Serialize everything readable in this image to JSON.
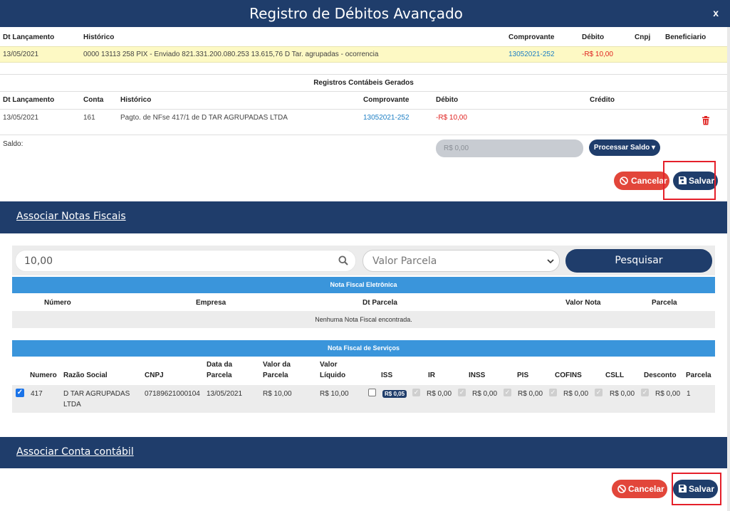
{
  "modal": {
    "title": "Registro de Débitos Avançado",
    "close": "x"
  },
  "debito": {
    "headers": [
      "Dt Lançamento",
      "Histórico",
      "Comprovante",
      "Débito",
      "Cnpj",
      "Beneficiario"
    ],
    "row": {
      "date": "13/05/2021",
      "historico": "0000 13113 258 PIX - Enviado 821.331.200.080.253 13.615,76 D Tar. agrupadas - ocorrencia",
      "comprovante": "13052021-252",
      "debito": "-R$ 10,00"
    }
  },
  "registros": {
    "title": "Registros Contábeis Gerados",
    "headers": [
      "Dt Lançamento",
      "Conta",
      "Histórico",
      "Comprovante",
      "Débito",
      "Crédito"
    ],
    "row": {
      "date": "13/05/2021",
      "conta": "161",
      "historico": "Pagto. de NFse 417/1 de D TAR AGRUPADAS LTDA",
      "comprovante": "13052021-252",
      "debito": "-R$ 10,00"
    }
  },
  "saldo": {
    "label": "Saldo:",
    "value": "R$ 0,00",
    "processar": "Processar Saldo ▾"
  },
  "actions": {
    "cancel": "Cancelar",
    "save": "Salvar"
  },
  "notas": {
    "panel_title": "Associar Notas Fiscais",
    "search_value": "10,00",
    "select_value": "Valor Parcela",
    "search_button": "Pesquisar",
    "nfe": {
      "title": "Nota Fiscal Eletrônica",
      "headers": [
        "Número",
        "Empresa",
        "Dt Parcela",
        "Valor Nota",
        "Parcela"
      ],
      "empty": "Nenhuma Nota Fiscal encontrada."
    },
    "nfs": {
      "title": "Nota Fiscal de Serviços",
      "headers": {
        "numero": "Numero",
        "razao": "Razão Social",
        "cnpj": "CNPJ",
        "data1": "Data da",
        "data2": "Parcela",
        "valor1": "Valor da",
        "valor2": "Parcela",
        "liq1": "Valor",
        "liq2": "Líquido",
        "iss": "ISS",
        "ir": "IR",
        "inss": "INSS",
        "pis": "PIS",
        "cofins": "COFINS",
        "csll": "CSLL",
        "desconto": "Desconto",
        "parcela": "Parcela"
      },
      "row": {
        "numero": "417",
        "razao1": "D TAR AGRUPADAS",
        "razao2": "LTDA",
        "cnpj": "07189621000104",
        "data": "13/05/2021",
        "valor": "R$ 10,00",
        "liquido": "R$ 10,00",
        "iss_badge": "R$ 0,05",
        "ir": "R$ 0,00",
        "inss": "R$ 0,00",
        "pis": "R$ 0,00",
        "cofins": "R$ 0,00",
        "csll": "R$ 0,00",
        "desconto": "R$ 0,00",
        "parcela": "1"
      }
    }
  },
  "conta": {
    "panel_title": "Associar Conta contábil"
  },
  "colors": {
    "navy": "#1f3d6b",
    "blue": "#3a95db",
    "red": "#e2463a",
    "highlight": "#e5202a",
    "yellow": "#fdf9c4"
  }
}
